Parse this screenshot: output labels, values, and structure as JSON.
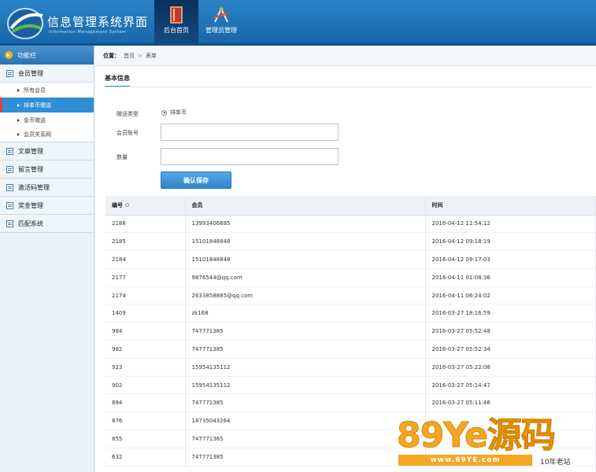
{
  "header": {
    "title": "信息管理系统界面",
    "subtitle": "Information Management System",
    "tabs": [
      {
        "label": "后台首页",
        "icon": "book-icon",
        "active": true
      },
      {
        "label": "管理员管理",
        "icon": "tools-icon",
        "active": false
      }
    ]
  },
  "sidebar": {
    "header": "功能栏",
    "groups": [
      {
        "label": "会员管理",
        "items": [
          {
            "label": "所有会员",
            "active": false
          },
          {
            "label": "排单币赠送",
            "active": true
          },
          {
            "label": "金币赠送",
            "active": false
          },
          {
            "label": "会员关系网",
            "active": false
          }
        ]
      },
      {
        "label": "文章管理"
      },
      {
        "label": "留言管理"
      },
      {
        "label": "激活码管理"
      },
      {
        "label": "奖金管理"
      },
      {
        "label": "匹配系统"
      }
    ]
  },
  "breadcrumb": {
    "prefix": "位置：",
    "items": [
      "首页",
      "表单"
    ]
  },
  "section_title": "基本信息",
  "form": {
    "type_label": "赠送类型",
    "type_value": "排单币",
    "account_label": "会员账号",
    "account_value": "",
    "quantity_label": "数量",
    "quantity_value": "",
    "save_label": "确认保存"
  },
  "table": {
    "headers": [
      "编号",
      "会员",
      "时间"
    ],
    "rows": [
      [
        "2188",
        "13993406685",
        "2016-04-12 11:54:12"
      ],
      [
        "2185",
        "15101848848",
        "2016-04-12 09:18:19"
      ],
      [
        "2184",
        "15101848848",
        "2016-04-12 09:17:03"
      ],
      [
        "2177",
        "9876544@qq.com",
        "2016-04-11 01:08:36"
      ],
      [
        "2174",
        "2633858885@qq.com",
        "2016-04-11 06:24:02"
      ],
      [
        "1409",
        "zk168",
        "2016-03-27 18:16:59"
      ],
      [
        "984",
        "747771385",
        "2016-03-27 05:52:48"
      ],
      [
        "982",
        "747771385",
        "2016-03-27 05:52:34"
      ],
      [
        "923",
        "15954135112",
        "2016-03-27 05:22:08"
      ],
      [
        "902",
        "15954135112",
        "2016-03-27 05:14:47"
      ],
      [
        "894",
        "747771385",
        "2016-03-27 05:11:46"
      ],
      [
        "876",
        "18735043264",
        ""
      ],
      [
        "855",
        "747771385",
        ""
      ],
      [
        "632",
        "747771385",
        ""
      ]
    ]
  },
  "watermark": {
    "brand": "89Ye源码",
    "url": "www.89YE.com",
    "tag": "10年老站"
  },
  "colors": {
    "header_blue": "#1f74b8",
    "accent": "#2f8fd6",
    "watermark_orange": "#f5a623"
  }
}
